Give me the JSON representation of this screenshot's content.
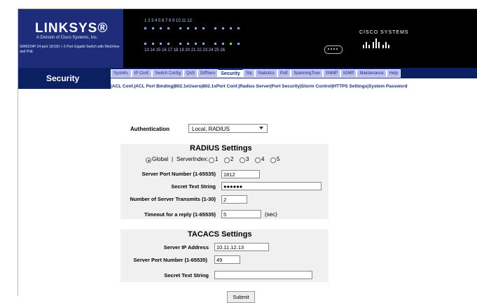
{
  "brand": {
    "logo": "LINKSYS®",
    "tagline": "A Division of Cisco Systems, Inc.",
    "model": "SRW224P 24-port 10/100 + 2-Port Gigabit Switch with WebView and PoE",
    "cisco": "CISCO SYSTEMS"
  },
  "section_title": "Security",
  "tabs": [
    {
      "label": "SysInfo."
    },
    {
      "label": "IP Conf."
    },
    {
      "label": "Switch Config"
    },
    {
      "label": "QoS"
    },
    {
      "label": "DiffServ"
    },
    {
      "label": "Security"
    },
    {
      "label": "Stp"
    },
    {
      "label": "Statistics"
    },
    {
      "label": "PoE"
    },
    {
      "label": "SpanningTree"
    },
    {
      "label": "SNMP"
    },
    {
      "label": "IGMP"
    },
    {
      "label": "Maintenance"
    },
    {
      "label": "Help"
    }
  ],
  "active_tab": "Security",
  "subnav": [
    "|ACL Conf.",
    "|ACL Port Binding",
    "|802.1xUsers",
    "|802.1xPort Conf.",
    "|Radius Server",
    "|Port Security",
    "|Storm Control",
    "|HTTPS Settings",
    "|System Password"
  ],
  "authentication": {
    "label": "Authentication",
    "value": "Local, RADIUS"
  },
  "radius": {
    "title": "RADIUS Settings",
    "global_label": "Global",
    "separator": "|",
    "serverindex_label": "ServerIndex:",
    "indices": [
      "1",
      "2",
      "3",
      "4",
      "5"
    ],
    "selected_index": "global",
    "port_label": "Server Port Number (1-65535)",
    "port_value": "1812",
    "secret_label": "Secret Text String",
    "secret_value": "●●●●●●",
    "transmits_label": "Number of Server Transmits (1-30)",
    "transmits_value": "2",
    "timeout_label": "Timeout for a reply (1-65535)",
    "timeout_value": "5",
    "timeout_unit": "(sec)"
  },
  "tacacs": {
    "title": "TACACS Settings",
    "ip_label": "Server IP Address",
    "ip_value": "10.11.12.13",
    "port_label": "Server Port Number (1-65535)",
    "port_value": "49",
    "secret_label": "Secret Text String",
    "secret_value": ""
  },
  "submit_label": "Submit",
  "port_numbers_top": "1 2 3 4   5 6 7 8   9 10 11 12",
  "port_numbers_bottom": "13 14 15 16   17 18 19 20   21 22 23 24   25 26",
  "colors": {
    "nav_dark": "#0b2061",
    "tab_bg": "#b8bff0",
    "panel_bg": "#f0f0f0"
  }
}
